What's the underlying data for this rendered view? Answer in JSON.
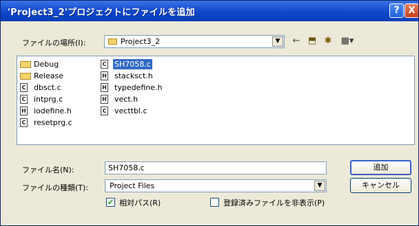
{
  "title": "'Project3_2'プロジェクトにファイルを追加",
  "titlebar": {
    "help_glyph": "?",
    "close_glyph": "X"
  },
  "look_in": {
    "label": "ファイルの場所(I):",
    "value": "Project3_2"
  },
  "toolbar": {
    "back_glyph": "←",
    "up_glyph": "⬒",
    "newfolder_glyph": "✱",
    "views_glyph": "▦▾"
  },
  "files": [
    {
      "name": "Debug",
      "kind": "folder"
    },
    {
      "name": "Release",
      "kind": "folder"
    },
    {
      "name": "dbsct.c",
      "kind": "c"
    },
    {
      "name": "intprg.c",
      "kind": "c"
    },
    {
      "name": "iodefine.h",
      "kind": "h"
    },
    {
      "name": "resetprg.c",
      "kind": "c"
    },
    {
      "name": "SH7058.c",
      "kind": "c",
      "selected": true
    },
    {
      "name": "stacksct.h",
      "kind": "h"
    },
    {
      "name": "typedefine.h",
      "kind": "h"
    },
    {
      "name": "vect.h",
      "kind": "h"
    },
    {
      "name": "vecttbl.c",
      "kind": "c"
    }
  ],
  "file_icon_glyphs": {
    "c": "C",
    "h": "H"
  },
  "filename": {
    "label": "ファイル名(N):",
    "value": "SH7058.c"
  },
  "filetype": {
    "label": "ファイルの種類(T):",
    "value": "Project Files"
  },
  "buttons": {
    "add": "追加",
    "cancel": "キャンセル"
  },
  "options": {
    "relative_path": {
      "label": "相対パス(R)",
      "checked": true
    },
    "hide_registered": {
      "label": "登録済みファイルを非表示(P)",
      "checked": false
    }
  },
  "colors": {
    "titlebar": "#0e45c8",
    "selection": "#316ac5",
    "dialog_bg": "#ece9d8"
  }
}
